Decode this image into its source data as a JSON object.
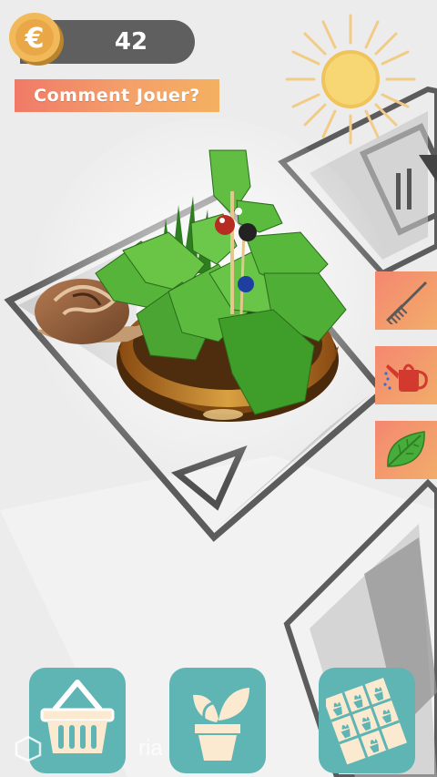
{
  "hud": {
    "coins": "42",
    "how_to_play_label": "Comment Jouer?",
    "coin_symbol": "€"
  },
  "tools": [
    {
      "name": "rake",
      "icon": "rake-icon"
    },
    {
      "name": "watering-can",
      "icon": "watering-can-icon"
    },
    {
      "name": "leaf",
      "icon": "leaf-icon"
    }
  ],
  "bottom_bar": [
    {
      "name": "shop",
      "icon": "basket-icon"
    },
    {
      "name": "plant",
      "icon": "potted-plant-icon"
    },
    {
      "name": "collection",
      "icon": "plant-grid-icon"
    }
  ],
  "watermark": "ria",
  "colors": {
    "button_orange_start": "#f07a67",
    "button_orange_end": "#f4b060",
    "teal": "#5fb4b4",
    "coin_bar": "#5f5f5f",
    "sun": "#f6d773"
  }
}
